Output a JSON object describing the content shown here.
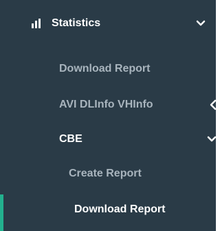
{
  "sidebar": {
    "statistics": {
      "label": "Statistics",
      "icon": "bar-chart-icon",
      "expanded": true
    },
    "items": [
      {
        "label": "Download Report"
      },
      {
        "label": "AVI DLInfo VHInfo",
        "icon": "chevron-left-icon",
        "expanded": false
      },
      {
        "label": "CBE",
        "icon": "chevron-down-icon",
        "expanded": true,
        "children": [
          {
            "label": "Create Report",
            "active": false
          },
          {
            "label": "Download Report",
            "active": true
          }
        ]
      }
    ]
  },
  "colors": {
    "background": "#2a3b47",
    "text_muted": "#a8b4bd",
    "text_bright": "#ffffff",
    "accent": "#23b08e"
  }
}
